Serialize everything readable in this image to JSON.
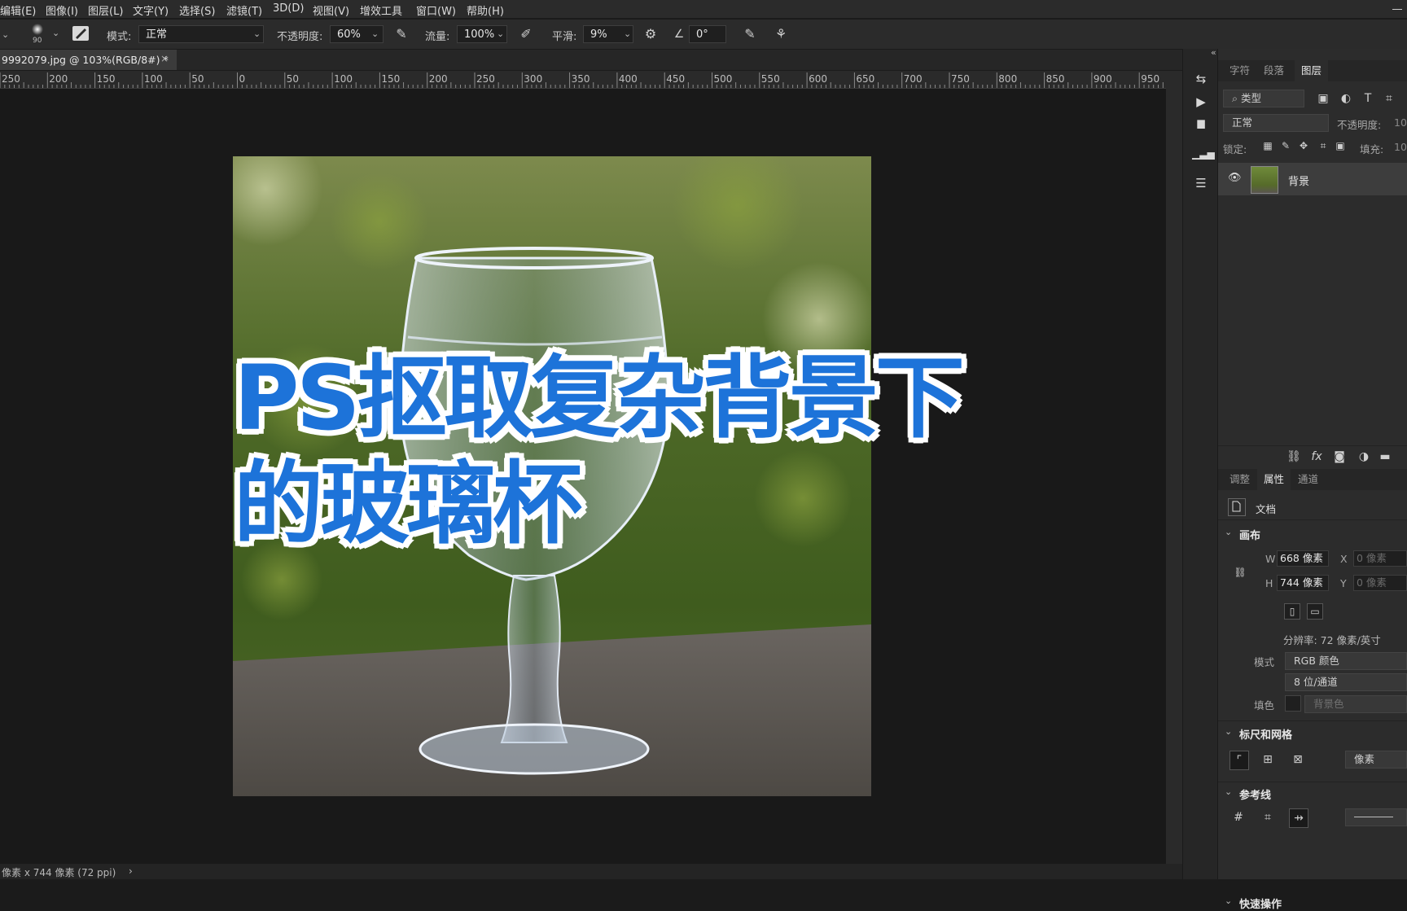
{
  "menu": [
    "编辑(E)",
    "图像(I)",
    "图层(L)",
    "文字(Y)",
    "选择(S)",
    "滤镜(T)",
    "3D(D)",
    "视图(V)",
    "增效工具",
    "窗口(W)",
    "帮助(H)"
  ],
  "options": {
    "brush_size": "90",
    "mode_label": "模式:",
    "mode_value": "正常",
    "opacity_label": "不透明度:",
    "opacity_value": "60%",
    "flow_label": "流量:",
    "flow_value": "100%",
    "smoothing_label": "平滑:",
    "smoothing_value": "9%",
    "angle_value": "0°"
  },
  "document": {
    "tab_title": "9992079.jpg @ 103%(RGB/8#) *",
    "tab_close": "×",
    "overlay_line1": "PS抠取复杂背景下",
    "overlay_line2": "的玻璃杯",
    "status": "像素 x 744 像素 (72 ppi)",
    "status_arrow": "›"
  },
  "ruler": {
    "labels": [
      "250",
      "200",
      "150",
      "100",
      "50",
      "0",
      "50",
      "100",
      "150",
      "200",
      "250",
      "300",
      "350",
      "400",
      "450",
      "500",
      "550",
      "600",
      "650",
      "700",
      "750",
      "800",
      "850",
      "900",
      "950"
    ]
  },
  "layers_panel": {
    "tabs": [
      "字符",
      "段落",
      "图层"
    ],
    "active_tab": "图层",
    "filter_placeholder": "类型",
    "blend_mode": "正常",
    "opacity_label": "不透明度:",
    "opacity_value": "10",
    "lock_label": "锁定:",
    "fill_label": "填充:",
    "fill_value": "10",
    "layer_name": "背景"
  },
  "properties_panel": {
    "tabs": [
      "调整",
      "属性",
      "通道"
    ],
    "active_tab": "属性",
    "doc_label": "文档",
    "canvas_section": "画布",
    "w_label": "W",
    "w_value": "668 像素",
    "h_label": "H",
    "h_value": "744 像素",
    "x_label": "X",
    "x_value": "0 像素",
    "y_label": "Y",
    "y_value": "0 像素",
    "resolution": "分辨率: 72 像素/英寸",
    "mode_label": "模式",
    "mode_value": "RGB 颜色",
    "depth_value": "8 位/通道",
    "fill_label": "填色",
    "fill_value": "背景色",
    "rulers_section": "标尺和网格",
    "ruler_unit": "像素",
    "guides_section": "参考线",
    "quick_section": "快速操作"
  }
}
